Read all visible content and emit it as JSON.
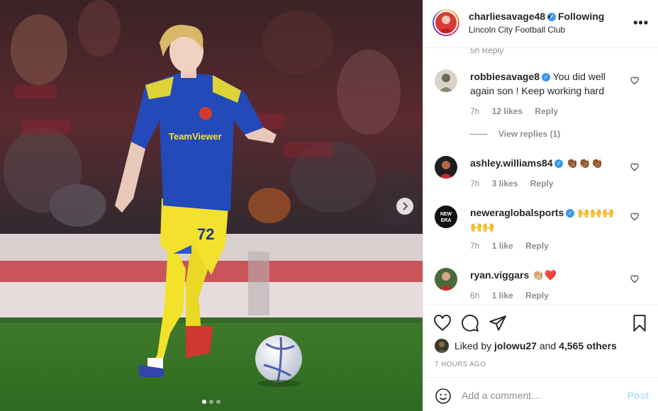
{
  "post": {
    "username": "charliesavage48",
    "separator": "•",
    "follow_label": "Following",
    "location": "Lincoln City Football Club",
    "more_label": "•••",
    "carousel_dots": 3,
    "active_dot": 0
  },
  "player": {
    "shirt_sponsor": "TeamViewer",
    "number": "72"
  },
  "cut_meta": "5h   Reply",
  "comments": [
    {
      "username": "robbiesavage8",
      "verified": true,
      "text": "You did well again son ! Keep working hard",
      "time": "7h",
      "likes": "12 likes",
      "reply_label": "Reply",
      "view_replies": "View replies (1)"
    },
    {
      "username": "ashley.williams84",
      "verified": true,
      "text": "👏🏾👏🏾👏🏾",
      "time": "7h",
      "likes": "3 likes",
      "reply_label": "Reply"
    },
    {
      "username": "neweraglobalsports",
      "verified": true,
      "text": "🙌🙌🙌🙌🙌",
      "time": "7h",
      "likes": "1 like",
      "reply_label": "Reply"
    },
    {
      "username": "ryan.viggars",
      "verified": false,
      "text": "👏🏼❤️",
      "time": "6h",
      "likes": "1 like",
      "reply_label": "Reply"
    }
  ],
  "likes_line": {
    "prefix": "Liked by ",
    "user": "jolowu27",
    "middle": " and ",
    "count": "4,565 others"
  },
  "timestamp": "7 HOURS AGO",
  "add_comment": {
    "placeholder": "Add a comment…",
    "post_label": "Post"
  },
  "colors": {
    "verified": "#3897f0",
    "post_disabled": "#b2dffc",
    "heart_liked": "#ed4956"
  }
}
